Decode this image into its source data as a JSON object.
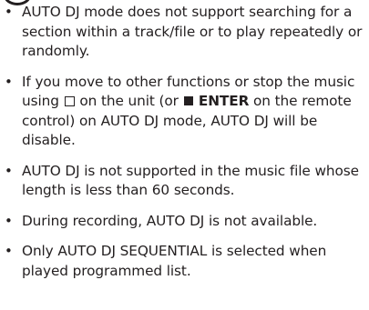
{
  "notes": [
    {
      "text": "AUTO DJ mode does not support searching for a section within a track/file or to play repeatedly or randomly."
    },
    {
      "part1": "If you move to other functions or stop the music using ",
      "stop_icon": "stop-square-icon",
      "part2": " on the unit (or ",
      "stop_fill_icon": "stop-filled-square-icon",
      "enter_label": " ENTER",
      "part3": " on the remote control) on AUTO DJ mode, AUTO DJ will be disable."
    },
    {
      "text": "AUTO DJ is not supported in the music file whose length is less than 60 seconds."
    },
    {
      "text": "During recording, AUTO DJ is not available."
    },
    {
      "text": "Only AUTO DJ SEQUENTIAL is selected when played programmed list."
    }
  ]
}
